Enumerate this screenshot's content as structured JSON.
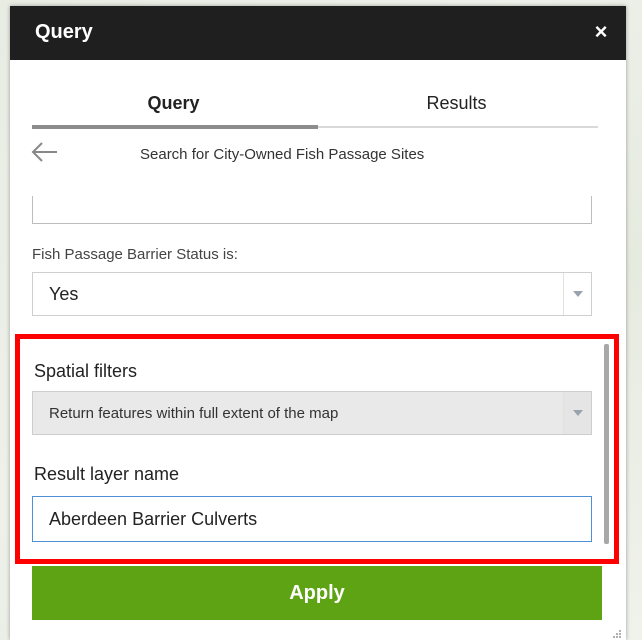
{
  "panel": {
    "title": "Query",
    "close_glyph": "×"
  },
  "tabs": [
    {
      "label": "Query",
      "active": true
    },
    {
      "label": "Results",
      "active": false
    }
  ],
  "task": {
    "back_icon": "arrow-left-icon",
    "title": "Search for City-Owned Fish Passage Sites"
  },
  "filters": {
    "status_label": "Fish Passage Barrier Status is:",
    "status_value": "Yes"
  },
  "spatial": {
    "label": "Spatial filters",
    "value": "Return features within full extent of the map"
  },
  "result": {
    "label": "Result layer name",
    "value": "Aberdeen Barrier Culverts"
  },
  "apply": {
    "label": "Apply"
  },
  "colors": {
    "titlebar": "#1f1f1f",
    "apply": "#5da314",
    "highlight": "#ff0000",
    "input_focus": "#4d90d6"
  }
}
